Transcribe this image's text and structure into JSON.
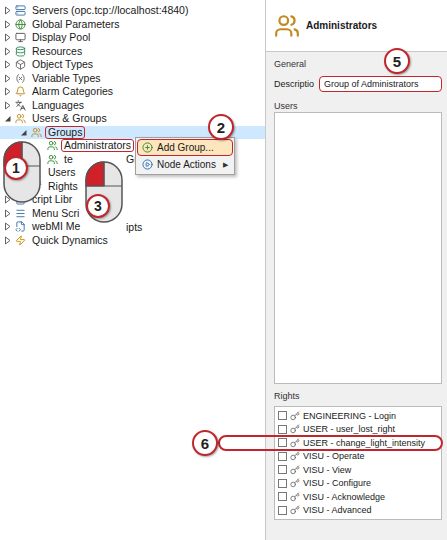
{
  "tree": [
    {
      "label": "Servers (opc.tcp://localhost:4840)",
      "depth": 0,
      "expandable": true,
      "expanded": false,
      "selected": false,
      "marked": false
    },
    {
      "label": "Global Parameters",
      "depth": 0,
      "expandable": true,
      "expanded": false,
      "selected": false,
      "marked": false
    },
    {
      "label": "Display Pool",
      "depth": 0,
      "expandable": true,
      "expanded": false,
      "selected": false,
      "marked": false
    },
    {
      "label": "Resources",
      "depth": 0,
      "expandable": true,
      "expanded": false,
      "selected": false,
      "marked": false
    },
    {
      "label": "Object Types",
      "depth": 0,
      "expandable": true,
      "expanded": false,
      "selected": false,
      "marked": false
    },
    {
      "label": "Variable Types",
      "depth": 0,
      "expandable": true,
      "expanded": false,
      "selected": false,
      "marked": false
    },
    {
      "label": "Alarm Categories",
      "depth": 0,
      "expandable": true,
      "expanded": false,
      "selected": false,
      "marked": false
    },
    {
      "label": "Languages",
      "depth": 0,
      "expandable": true,
      "expanded": false,
      "selected": false,
      "marked": false
    },
    {
      "label": "Users & Groups",
      "depth": 0,
      "expandable": true,
      "expanded": true,
      "selected": false,
      "marked": false
    },
    {
      "label": "Groups",
      "depth": 1,
      "expandable": true,
      "expanded": true,
      "selected": true,
      "marked": true
    },
    {
      "label": "Administrators",
      "depth": 2,
      "expandable": false,
      "expanded": false,
      "selected": false,
      "marked": true
    },
    {
      "label": "te",
      "tail": "Group",
      "depth": 2,
      "expandable": false,
      "expanded": false,
      "selected": false,
      "marked": false
    },
    {
      "label": "Users",
      "depth": 1,
      "expandable": true,
      "expanded": false,
      "selected": false,
      "marked": false
    },
    {
      "label": "Rights",
      "depth": 1,
      "expandable": false,
      "expanded": false,
      "selected": false,
      "marked": false
    },
    {
      "label": "cript Libr",
      "depth": 0,
      "expandable": true,
      "expanded": false,
      "selected": false,
      "marked": false
    },
    {
      "label": "Menu Scri",
      "depth": 0,
      "expandable": true,
      "expanded": false,
      "selected": false,
      "marked": false
    },
    {
      "label": "webMI Me",
      "tail": "ipts",
      "depth": 0,
      "expandable": true,
      "expanded": false,
      "selected": false,
      "marked": false
    },
    {
      "label": "Quick Dynamics",
      "depth": 0,
      "expandable": true,
      "expanded": false,
      "selected": false,
      "marked": false
    }
  ],
  "context_menu": [
    {
      "label": "Add Group...",
      "selected": true,
      "marked": true,
      "submenu": false
    },
    {
      "label": "Node Actions",
      "selected": false,
      "marked": false,
      "submenu": true,
      "arrow": "▶"
    }
  ],
  "panel": {
    "title": "Administrators",
    "general": {
      "heading": "General",
      "label": "Descriptio",
      "value": "Group of Administrators",
      "marked": true
    },
    "users": {
      "heading": "Users"
    },
    "rights": {
      "heading": "Rights",
      "items": [
        {
          "label": "ENGINEERING - Login",
          "checked": false,
          "marked": false
        },
        {
          "label": "USER - user_lost_right",
          "checked": false,
          "marked": false
        },
        {
          "label": "USER - change_light_intensity",
          "checked": false,
          "marked": true
        },
        {
          "label": "VISU - Operate",
          "checked": false,
          "marked": false
        },
        {
          "label": "VISU - View",
          "checked": false,
          "marked": false
        },
        {
          "label": "VISU - Configure",
          "checked": false,
          "marked": false
        },
        {
          "label": "VISU - Acknowledge",
          "checked": false,
          "marked": false
        },
        {
          "label": "VISU - Advanced",
          "checked": false,
          "marked": false
        }
      ]
    }
  },
  "callouts": [
    {
      "number": "1",
      "kind": "mouse"
    },
    {
      "number": "2",
      "kind": "circle"
    },
    {
      "number": "3",
      "kind": "mouse"
    },
    {
      "number": "5",
      "kind": "circle"
    },
    {
      "number": "6",
      "kind": "circle"
    }
  ]
}
